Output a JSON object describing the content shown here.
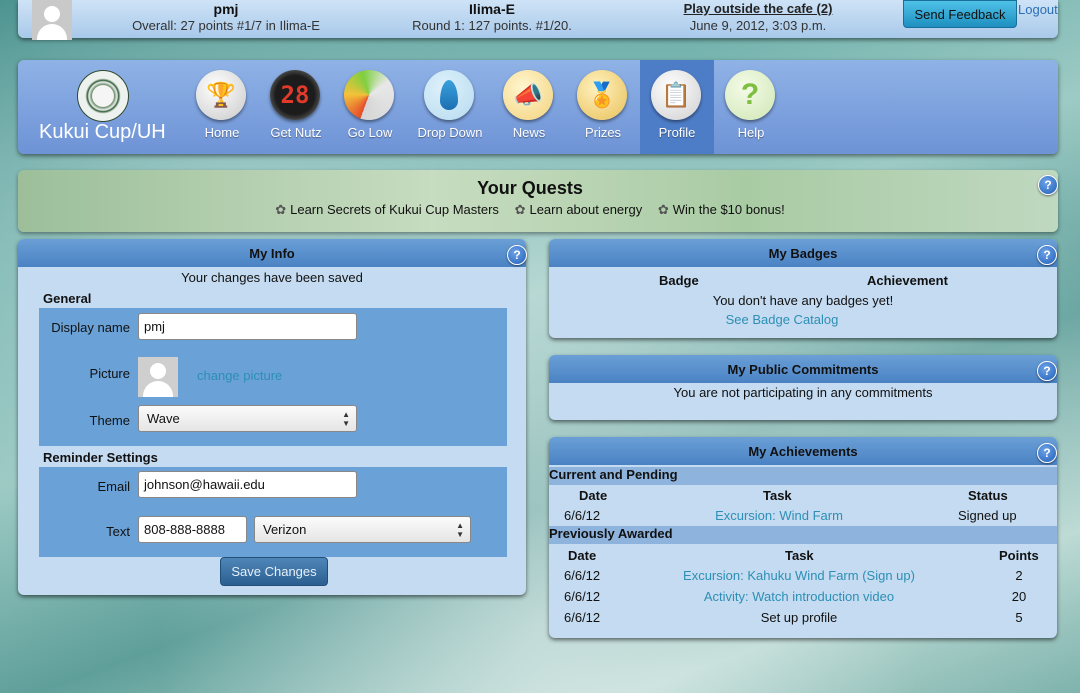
{
  "top": {
    "user_name": "pmj",
    "user_overall": "Overall: 27 points #1/7 in Ilima-E",
    "team_name": "Ilima-E",
    "team_round": "Round 1: 127 points. #1/20.",
    "event_title": "Play outside the cafe (2)",
    "event_time": "June 9, 2012, 3:03 p.m.",
    "feedback_label": "Send Feedback",
    "logout_label": "Logout"
  },
  "nav": {
    "site_title": "Kukui Cup/UH",
    "items": [
      {
        "label": "Home",
        "icon": "trophy-icon"
      },
      {
        "label": "Get Nutz",
        "icon": "counter-icon",
        "icon_text": "28"
      },
      {
        "label": "Go Low",
        "icon": "gauge-icon"
      },
      {
        "label": "Drop Down",
        "icon": "water-drop-icon"
      },
      {
        "label": "News",
        "icon": "megaphone-icon"
      },
      {
        "label": "Prizes",
        "icon": "ribbon-icon"
      },
      {
        "label": "Profile",
        "icon": "clipboard-icon"
      },
      {
        "label": "Help",
        "icon": "question-icon",
        "icon_text": "?"
      }
    ],
    "active": "Profile"
  },
  "quests": {
    "title": "Your Quests",
    "items": [
      "Learn Secrets of Kukui Cup Masters",
      "Learn about energy",
      "Win the $10 bonus!"
    ]
  },
  "help_glyph": "?",
  "my_info": {
    "title": "My Info",
    "status": "Your changes have been saved",
    "general_label": "General",
    "display_name_label": "Display name",
    "display_name_value": "pmj",
    "picture_label": "Picture",
    "change_picture": "change picture",
    "theme_label": "Theme",
    "theme_value": "Wave",
    "reminder_label": "Reminder Settings",
    "email_label": "Email",
    "email_value": "johnson@hawaii.edu",
    "text_label": "Text",
    "text_value": "808-888-8888",
    "carrier_value": "Verizon",
    "save_label": "Save Changes"
  },
  "badges": {
    "title": "My Badges",
    "col_badge": "Badge",
    "col_achievement": "Achievement",
    "empty": "You don't have any badges yet!",
    "catalog_link": "See Badge Catalog"
  },
  "commitments": {
    "title": "My Public Commitments",
    "empty": "You are not participating in any commitments"
  },
  "achievements": {
    "title": "My Achievements",
    "current_label": "Current and Pending",
    "current_cols": [
      "Date",
      "Task",
      "Status"
    ],
    "current_rows": [
      {
        "date": "6/6/12",
        "task": "Excursion: Wind Farm",
        "status": "Signed up"
      }
    ],
    "previous_label": "Previously Awarded",
    "previous_cols": [
      "Date",
      "Task",
      "Points"
    ],
    "previous_rows": [
      {
        "date": "6/6/12",
        "task": "Excursion: Kahuku Wind Farm (Sign up)",
        "points": "2"
      },
      {
        "date": "6/6/12",
        "task": "Activity: Watch introduction video",
        "points": "20"
      },
      {
        "date": "6/6/12",
        "task": "Set up profile",
        "points": "5"
      }
    ]
  }
}
